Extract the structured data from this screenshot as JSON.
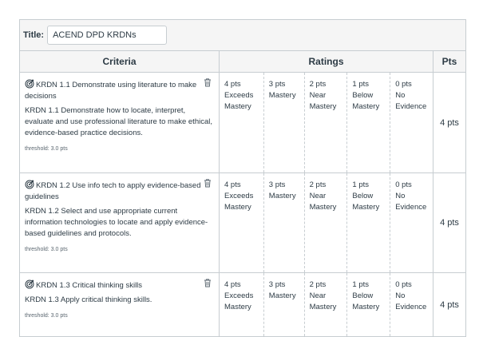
{
  "title": {
    "label": "Title:",
    "value": "ACEND DPD KRDNs"
  },
  "headers": {
    "criteria": "Criteria",
    "ratings": "Ratings",
    "pts": "Pts"
  },
  "criteria": [
    {
      "title": "KRDN 1.1 Demonstrate using literature to make decisions",
      "description": "KRDN 1.1 Demonstrate how to locate, interpret, evaluate and use professional literature to make ethical, evidence-based practice decisions.",
      "threshold": "threshold: 3.0 pts",
      "points": "4 pts",
      "ratings": [
        {
          "pts": "4 pts",
          "label": "Exceeds\nMastery"
        },
        {
          "pts": "3 pts",
          "label": "Mastery"
        },
        {
          "pts": "2 pts",
          "label": "Near\nMastery"
        },
        {
          "pts": "1 pts",
          "label": "Below\nMastery"
        },
        {
          "pts": "0 pts",
          "label": "No\nEvidence"
        }
      ]
    },
    {
      "title": "KRDN 1.2 Use info tech to apply evidence-based guidelines",
      "description": "KRDN 1.2 Select and use appropriate current information technologies to locate and apply evidence-based guidelines and protocols.",
      "threshold": "threshold: 3.0 pts",
      "points": "4 pts",
      "ratings": [
        {
          "pts": "4 pts",
          "label": "Exceeds\nMastery"
        },
        {
          "pts": "3 pts",
          "label": "Mastery"
        },
        {
          "pts": "2 pts",
          "label": "Near\nMastery"
        },
        {
          "pts": "1 pts",
          "label": "Below\nMastery"
        },
        {
          "pts": "0 pts",
          "label": "No\nEvidence"
        }
      ]
    },
    {
      "title": "KRDN 1.3 Critical thinking skills",
      "description": "KRDN 1.3 Apply critical thinking skills.",
      "threshold": "threshold: 3.0 pts",
      "points": "4 pts",
      "ratings": [
        {
          "pts": "4 pts",
          "label": "Exceeds\nMastery"
        },
        {
          "pts": "3 pts",
          "label": "Mastery"
        },
        {
          "pts": "2 pts",
          "label": "Near\nMastery"
        },
        {
          "pts": "1 pts",
          "label": "Below\nMastery"
        },
        {
          "pts": "0 pts",
          "label": "No\nEvidence"
        }
      ]
    }
  ]
}
